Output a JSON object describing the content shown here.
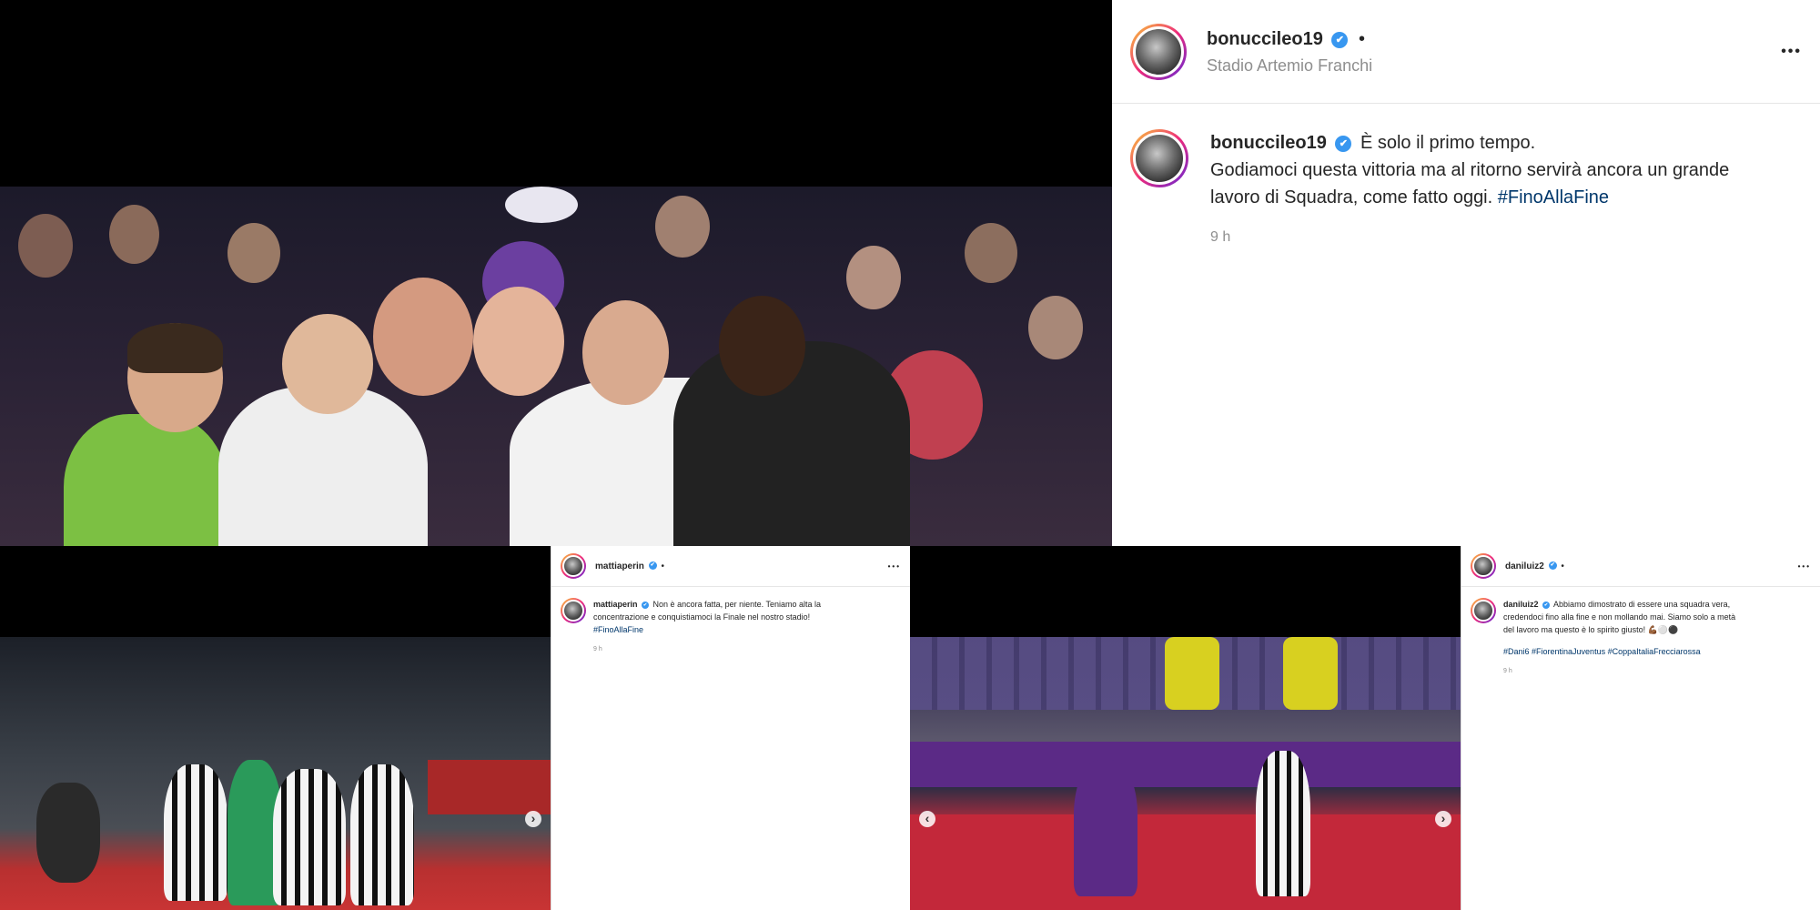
{
  "post1": {
    "username": "bonuccileo19",
    "location": "Stadio Artemio Franchi",
    "caption_line1": "È solo il primo tempo.",
    "caption_line2": "Godiamoci questa vittoria ma al ritorno servirà ancora un grande",
    "caption_line3": "lavoro di Squadra, come fatto oggi.",
    "hashtag": "#FinoAllaFine",
    "time": "9 h",
    "verified_icon": "✔",
    "more_icon": "•••",
    "separator": "•"
  },
  "post2": {
    "username": "mattiaperin",
    "caption_line1": "Non è ancora fatta, per niente. Teniamo alta la",
    "caption_line2": "concentrazione e conquistiamoci la Finale nel nostro stadio!",
    "hashtag": "#FinoAllaFine",
    "time": "9 h",
    "verified_icon": "✔",
    "more_icon": "•••",
    "separator": "•",
    "next_icon": "›"
  },
  "post3": {
    "username": "daniluiz2",
    "caption_line1": "Abbiamo dimostrato di essere una squadra vera,",
    "caption_line2": "credendoci fino alla fine e non mollando mai. Siamo solo a metà",
    "caption_line3": "del lavoro ma questo è lo spirito giusto! 💪🏾⚪⚫",
    "hashtags": "#Dani6 #FiorentinaJuventus #CoppaItaliaFrecciarossa",
    "time": "9 h",
    "verified_icon": "✔",
    "more_icon": "•••",
    "separator": "•",
    "prev_icon": "‹",
    "next_icon": "›"
  },
  "colors": {
    "accent": "#3897f0",
    "hashtag": "#00376b",
    "juve_black": "#111111",
    "fiorentina_purple": "#5b2a86"
  }
}
